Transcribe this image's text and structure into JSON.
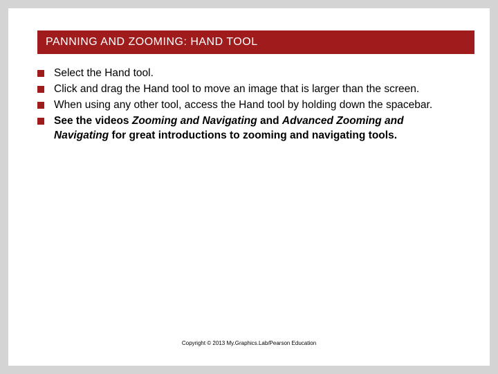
{
  "title": "PANNING AND ZOOMING: HAND TOOL",
  "bullets": {
    "b0": "Select the Hand tool.",
    "b1": "Click and drag the Hand tool to move an image that is larger than the screen.",
    "b2": "When using any other tool, access the Hand tool by holding down the spacebar.",
    "b3_prefix": "See the videos ",
    "b3_video1": "Zooming and Navigating",
    "b3_and": " and ",
    "b3_video2": "Advanced Zooming and Navigating",
    "b3_suffix": " for great introductions to zooming and navigating tools."
  },
  "footer": "Copyright © 2013 My.Graphics.Lab/Pearson Education"
}
